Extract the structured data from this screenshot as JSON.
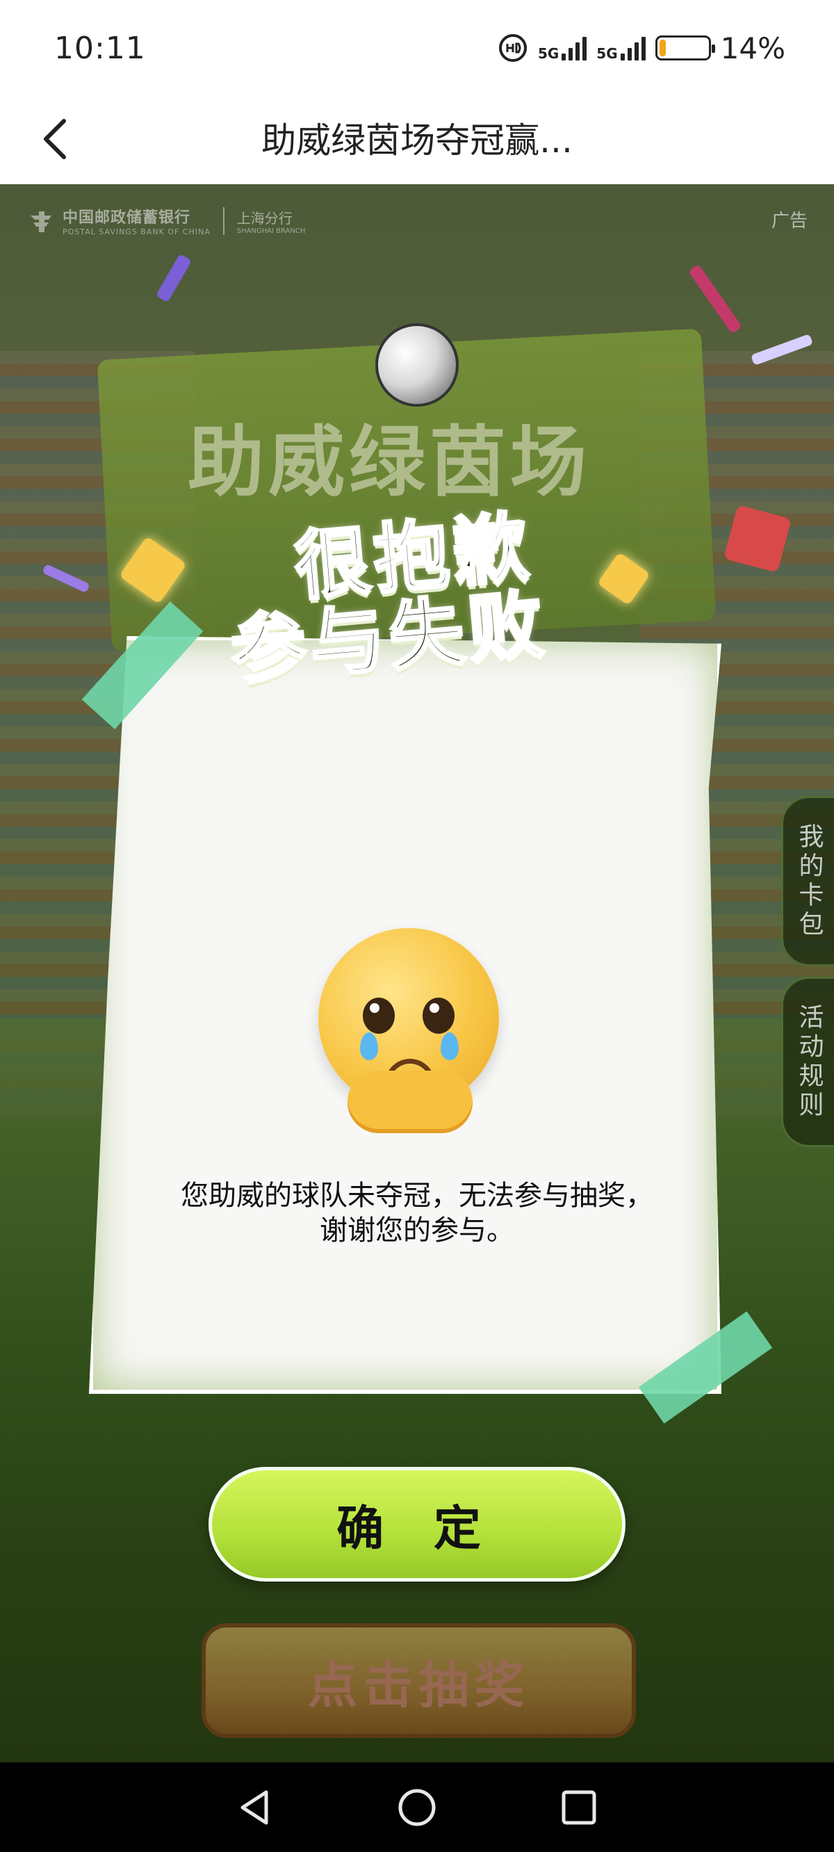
{
  "status_bar": {
    "time": "10:11",
    "network_1": "5G",
    "network_2": "5G",
    "battery_percent_text": "14%",
    "battery_level": 0.14,
    "battery_color": "#f2a51a"
  },
  "title_bar": {
    "title": "助威绿茵场夺冠赢..."
  },
  "banner": {
    "bank_name_cn": "中国邮政储蓄银行",
    "bank_name_en": "POSTAL SAVINGS BANK OF CHINA",
    "branch_cn": "上海分行",
    "branch_en": "SHANGHAI BRANCH",
    "ad_label": "广告",
    "campaign_title": "助威绿茵场"
  },
  "dialog": {
    "heading_line1": "很抱歉",
    "heading_line2": "参与失败",
    "message": "您助威的球队未夺冠，无法参与抽奖，谢谢您的参与。",
    "confirm_label": "确 定"
  },
  "page": {
    "draw_button_label": "点击抽奖",
    "side_tab_card": "我的卡包",
    "side_tab_rules": "活动规则"
  },
  "icons": {
    "back": "chevron-left-icon",
    "nav_back": "triangle-back-icon",
    "nav_home": "circle-home-icon",
    "nav_recents": "square-recents-icon"
  },
  "colors": {
    "confirm_green": "#b3e13a",
    "tape_mint": "#6fd6a8",
    "heading_dark": "#1f2d14"
  }
}
